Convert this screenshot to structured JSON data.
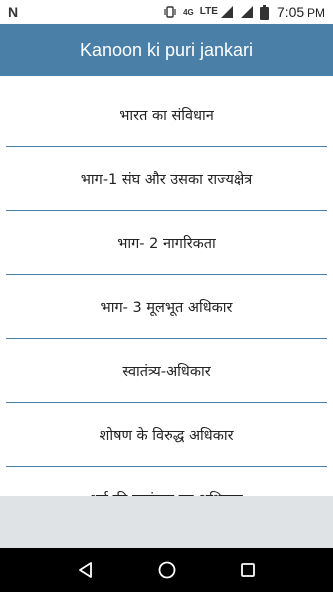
{
  "status_bar": {
    "time": "7:05",
    "ampm": "PM",
    "network": "4G",
    "lte": "LTE"
  },
  "app_bar": {
    "title": "Kanoon ki puri jankari"
  },
  "list": {
    "items": [
      "भारत का संविधान",
      "भाग-1 संघ और उसका राज्यक्षेत्र",
      "भाग- 2 नागरिकता",
      "भाग- 3 मूलभूत अधिकार",
      "स्वातंत्र्य-अधिकार",
      "शोषण के विरुद्ध अधिकार",
      "धर्म की स्वतंत्रता का अधिकार"
    ]
  },
  "colors": {
    "app_bar": "#4a7fa8",
    "divider": "#4a7fa8",
    "nav_bar": "#000000",
    "footer_area": "#dfe3e6"
  },
  "icons": {
    "status_left": "notification-n-icon",
    "vibrate": "vibrate-icon",
    "signal": "cell-signal-icon",
    "battery": "battery-icon",
    "back": "back-triangle-icon",
    "home": "home-circle-icon",
    "recents": "recents-square-icon"
  }
}
